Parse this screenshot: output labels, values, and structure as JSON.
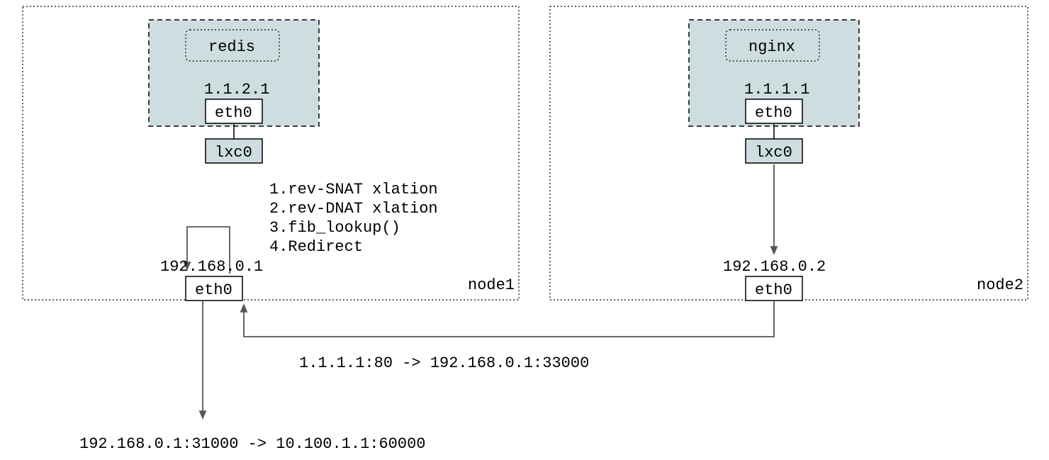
{
  "node1": {
    "label": "node1",
    "pod": {
      "service": "redis",
      "ip": "1.1.2.1",
      "iface": "eth0"
    },
    "host_iface_bridge": "lxc0",
    "host_ip": "192.168.0.1",
    "host_iface": "eth0",
    "steps": [
      "1.rev-SNAT xlation",
      "2.rev-DNAT xlation",
      "3.fib_lookup()",
      "4.Redirect"
    ]
  },
  "node2": {
    "label": "node2",
    "pod": {
      "service": "nginx",
      "ip": "1.1.1.1",
      "iface": "eth0"
    },
    "host_iface_bridge": "lxc0",
    "host_ip": "192.168.0.2",
    "host_iface": "eth0"
  },
  "flows": {
    "inter_node": "1.1.1.1:80 -> 192.168.0.1:33000",
    "egress": "192.168.0.1:31000 -> 10.100.1.1:60000"
  }
}
